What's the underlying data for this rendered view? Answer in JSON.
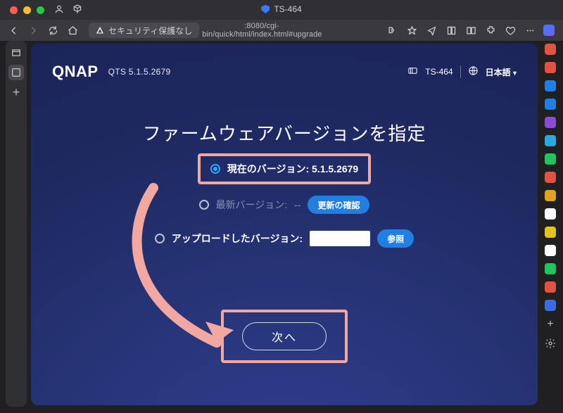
{
  "window": {
    "title": "TS-464"
  },
  "addressbar": {
    "security_text": "セキュリティ保護なし",
    "url_suffix": ":8080/cgi-bin/quick/html/index.html#upgrade"
  },
  "header": {
    "brand": "QNAP",
    "firmware": "QTS 5.1.5.2679",
    "model": "TS-464",
    "language": "日本語"
  },
  "page": {
    "title": "ファームウェアバージョンを指定",
    "options": {
      "current": {
        "label": "現在のバージョン:",
        "value": "5.1.5.2679"
      },
      "latest": {
        "label": "最新バージョン:",
        "value": "--",
        "check_button": "更新の確認"
      },
      "upload": {
        "label": "アップロードしたバージョン:",
        "browse_button": "参照"
      }
    },
    "next_button": "次へ"
  },
  "ext_colors": [
    "#e25241",
    "#e25241",
    "#1f7fe2",
    "#1f7fe2",
    "#8a4bd6",
    "#2aa8e2",
    "#1fc65b",
    "#e25241",
    "#e2a21f",
    "#ffffff",
    "#e2c21f",
    "#ffffff",
    "#1fc65b",
    "#e25241",
    "#3a6be2"
  ]
}
